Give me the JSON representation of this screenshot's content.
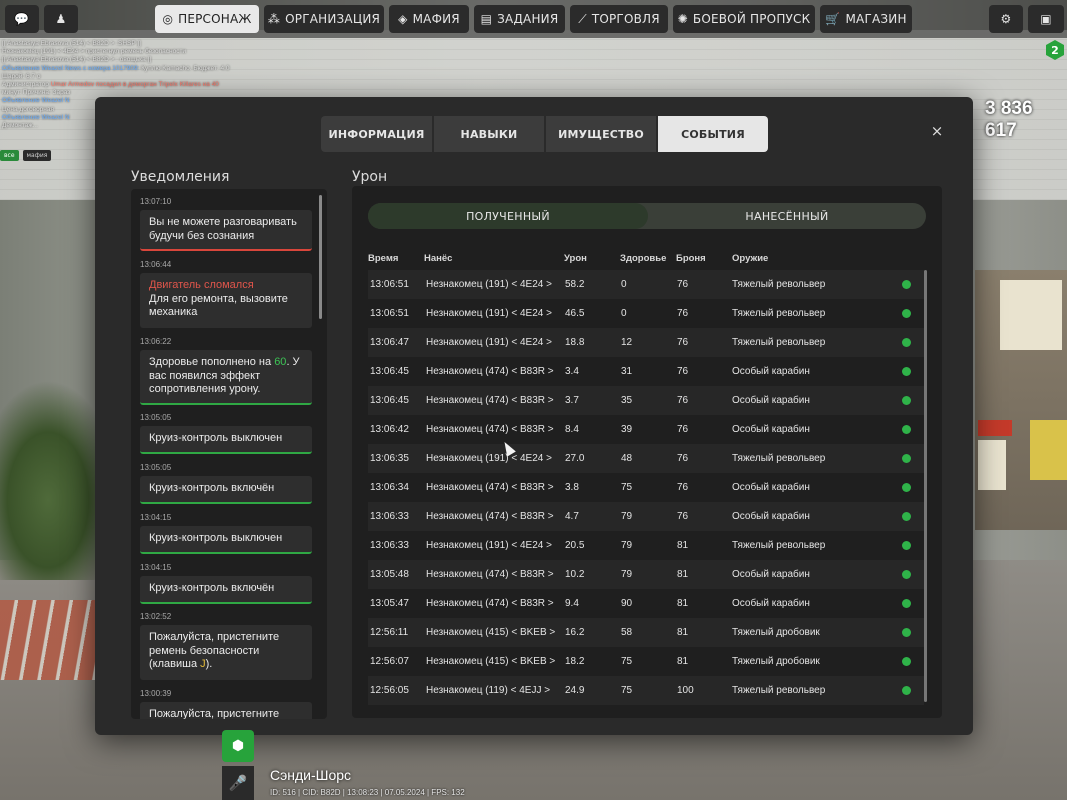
{
  "topbar": {
    "chat_icon": "chat-bubble-icon",
    "profile_icon": "person-icon",
    "buttons": [
      {
        "label": "ПЕРСОНАЖ",
        "icon": "user-circle-icon"
      },
      {
        "label": "ОРГАНИЗАЦИЯ",
        "icon": "org-icon"
      },
      {
        "label": "МАФИЯ",
        "icon": "mask-icon"
      },
      {
        "label": "ЗАДАНИЯ",
        "icon": "tasks-icon"
      },
      {
        "label": "ТОРГОВЛЯ",
        "icon": "chart-icon"
      },
      {
        "label": "БОЕВОЙ ПРОПУСК",
        "icon": "gear-badge-icon"
      },
      {
        "label": "МАГАЗИН",
        "icon": "cart-icon"
      }
    ],
    "settings_icon": "gear-icon",
    "extra_icon": "window-icon"
  },
  "money": "3 836 617",
  "badge_level": "2",
  "chat": {
    "lines": [
      {
        "prefix": "",
        "text": "[[ Anastasiya Ebrasova (514) < B82D > :SHSP ]]",
        "cls": ""
      },
      {
        "prefix": "",
        "text": "Незнакомец (191) < 4E24 > пристегнул ремень безопасности",
        "cls": ""
      },
      {
        "prefix": "",
        "text": "[[ Anastasiya Ebrasova (514) < B82D > : овощька ]]",
        "cls": ""
      },
      {
        "prefix": "Объявление Weazel News с номера 1017909:",
        "text": "Куплю Kamacho. Бюджет: 4.0",
        "cls": "blue"
      },
      {
        "prefix": "",
        "text": "Шарой: 6.7 о",
        "cls": ""
      },
      {
        "prefix": "Администратор",
        "text": "Umar Armedov посадил в деморган Tripelx Killares на 40",
        "cls": "red"
      },
      {
        "prefix": "",
        "text": "минут. Причина: Зараз",
        "cls": ""
      },
      {
        "prefix": "Объявление Weazel N",
        "text": "",
        "cls": "blue"
      },
      {
        "prefix": "",
        "text": "Цена договорная",
        "cls": ""
      },
      {
        "prefix": "Объявление Weazel N",
        "text": "",
        "cls": "blue"
      },
      {
        "prefix": "",
        "text": "Демонтаж...",
        "cls": ""
      }
    ],
    "tab_all": "все",
    "tab_mafia": "мафия"
  },
  "modal": {
    "tabs": [
      "ИНФОРМАЦИЯ",
      "НАВЫКИ",
      "ИМУЩЕСТВО",
      "СОБЫТИЯ"
    ],
    "active_tab": "СОБЫТИЯ",
    "close_label": "×"
  },
  "notifications": {
    "title": "Уведомления",
    "items": [
      {
        "time": "13:07:10",
        "text": "Вы не можете разговаривать будучи без сознания",
        "accent": "red"
      },
      {
        "time": "13:06:44",
        "title_red": "Двигатель сломался",
        "text": "Для его ремонта, вызовите механика",
        "accent": "none"
      },
      {
        "time": "13:06:22",
        "text_before": "Здоровье пополнено на ",
        "highlight": "60",
        "text_after": ". У вас появился эффект сопротивления урону.",
        "accent": "green"
      },
      {
        "time": "13:05:05",
        "text": "Круиз-контроль выключен",
        "accent": "green"
      },
      {
        "time": "13:05:05",
        "text": "Круиз-контроль включён",
        "accent": "green"
      },
      {
        "time": "13:04:15",
        "text": "Круиз-контроль выключен",
        "accent": "green"
      },
      {
        "time": "13:04:15",
        "text": "Круиз-контроль включён",
        "accent": "green"
      },
      {
        "time": "13:02:52",
        "text_before": "Пожалуйста, пристегните ремень безопасности (клавиша ",
        "highlight": "J",
        "text_after": ").",
        "accent": "none"
      },
      {
        "time": "13:00:39",
        "text": "Пожалуйста, пристегните",
        "accent": "none"
      }
    ]
  },
  "damage": {
    "title": "Урон",
    "segment_received": "ПОЛУЧЕННЫЙ",
    "segment_dealt": "НАНЕСЁННЫЙ",
    "columns": [
      "Время",
      "Нанёс",
      "Урон",
      "Здоровье",
      "Броня",
      "Оружие"
    ],
    "rows": [
      {
        "time": "13:06:51",
        "by": "Незнакомец (191) < 4E24 >",
        "damage": "58.2",
        "health": "0",
        "armor": "76",
        "weapon": "Тяжелый револьвер"
      },
      {
        "time": "13:06:51",
        "by": "Незнакомец (191) < 4E24 >",
        "damage": "46.5",
        "health": "0",
        "armor": "76",
        "weapon": "Тяжелый револьвер"
      },
      {
        "time": "13:06:47",
        "by": "Незнакомец (191) < 4E24 >",
        "damage": "18.8",
        "health": "12",
        "armor": "76",
        "weapon": "Тяжелый револьвер"
      },
      {
        "time": "13:06:45",
        "by": "Незнакомец (474) < B83R >",
        "damage": "3.4",
        "health": "31",
        "armor": "76",
        "weapon": "Особый карабин"
      },
      {
        "time": "13:06:45",
        "by": "Незнакомец (474) < B83R >",
        "damage": "3.7",
        "health": "35",
        "armor": "76",
        "weapon": "Особый карабин"
      },
      {
        "time": "13:06:42",
        "by": "Незнакомец (474) < B83R >",
        "damage": "8.4",
        "health": "39",
        "armor": "76",
        "weapon": "Особый карабин"
      },
      {
        "time": "13:06:35",
        "by": "Незнакомец (191) < 4E24 >",
        "damage": "27.0",
        "health": "48",
        "armor": "76",
        "weapon": "Тяжелый револьвер"
      },
      {
        "time": "13:06:34",
        "by": "Незнакомец (474) < B83R >",
        "damage": "3.8",
        "health": "75",
        "armor": "76",
        "weapon": "Особый карабин"
      },
      {
        "time": "13:06:33",
        "by": "Незнакомец (474) < B83R >",
        "damage": "4.7",
        "health": "79",
        "armor": "76",
        "weapon": "Особый карабин"
      },
      {
        "time": "13:06:33",
        "by": "Незнакомец (191) < 4E24 >",
        "damage": "20.5",
        "health": "79",
        "armor": "81",
        "weapon": "Тяжелый револьвер"
      },
      {
        "time": "13:05:48",
        "by": "Незнакомец (474) < B83R >",
        "damage": "10.2",
        "health": "79",
        "armor": "81",
        "weapon": "Особый карабин"
      },
      {
        "time": "13:05:47",
        "by": "Незнакомец (474) < B83R >",
        "damage": "9.4",
        "health": "90",
        "armor": "81",
        "weapon": "Особый карабин"
      },
      {
        "time": "12:56:11",
        "by": "Незнакомец (415) < BKEB >",
        "damage": "16.2",
        "health": "58",
        "armor": "81",
        "weapon": "Тяжелый дробовик"
      },
      {
        "time": "12:56:07",
        "by": "Незнакомец (415) < BKEB >",
        "damage": "18.2",
        "health": "75",
        "armor": "81",
        "weapon": "Тяжелый дробовик"
      },
      {
        "time": "12:56:05",
        "by": "Незнакомец (119) < 4EJJ >",
        "damage": "24.9",
        "health": "75",
        "armor": "100",
        "weapon": "Тяжелый револьвер"
      }
    ],
    "row_icon": "info-dot-icon",
    "accent_color": "#2fb349"
  },
  "status": {
    "location": "Сэнди-Шорс",
    "line": "ID: 516 | CID: B82D | 13:08:23 | 07.05.2024 | FPS: 132"
  }
}
